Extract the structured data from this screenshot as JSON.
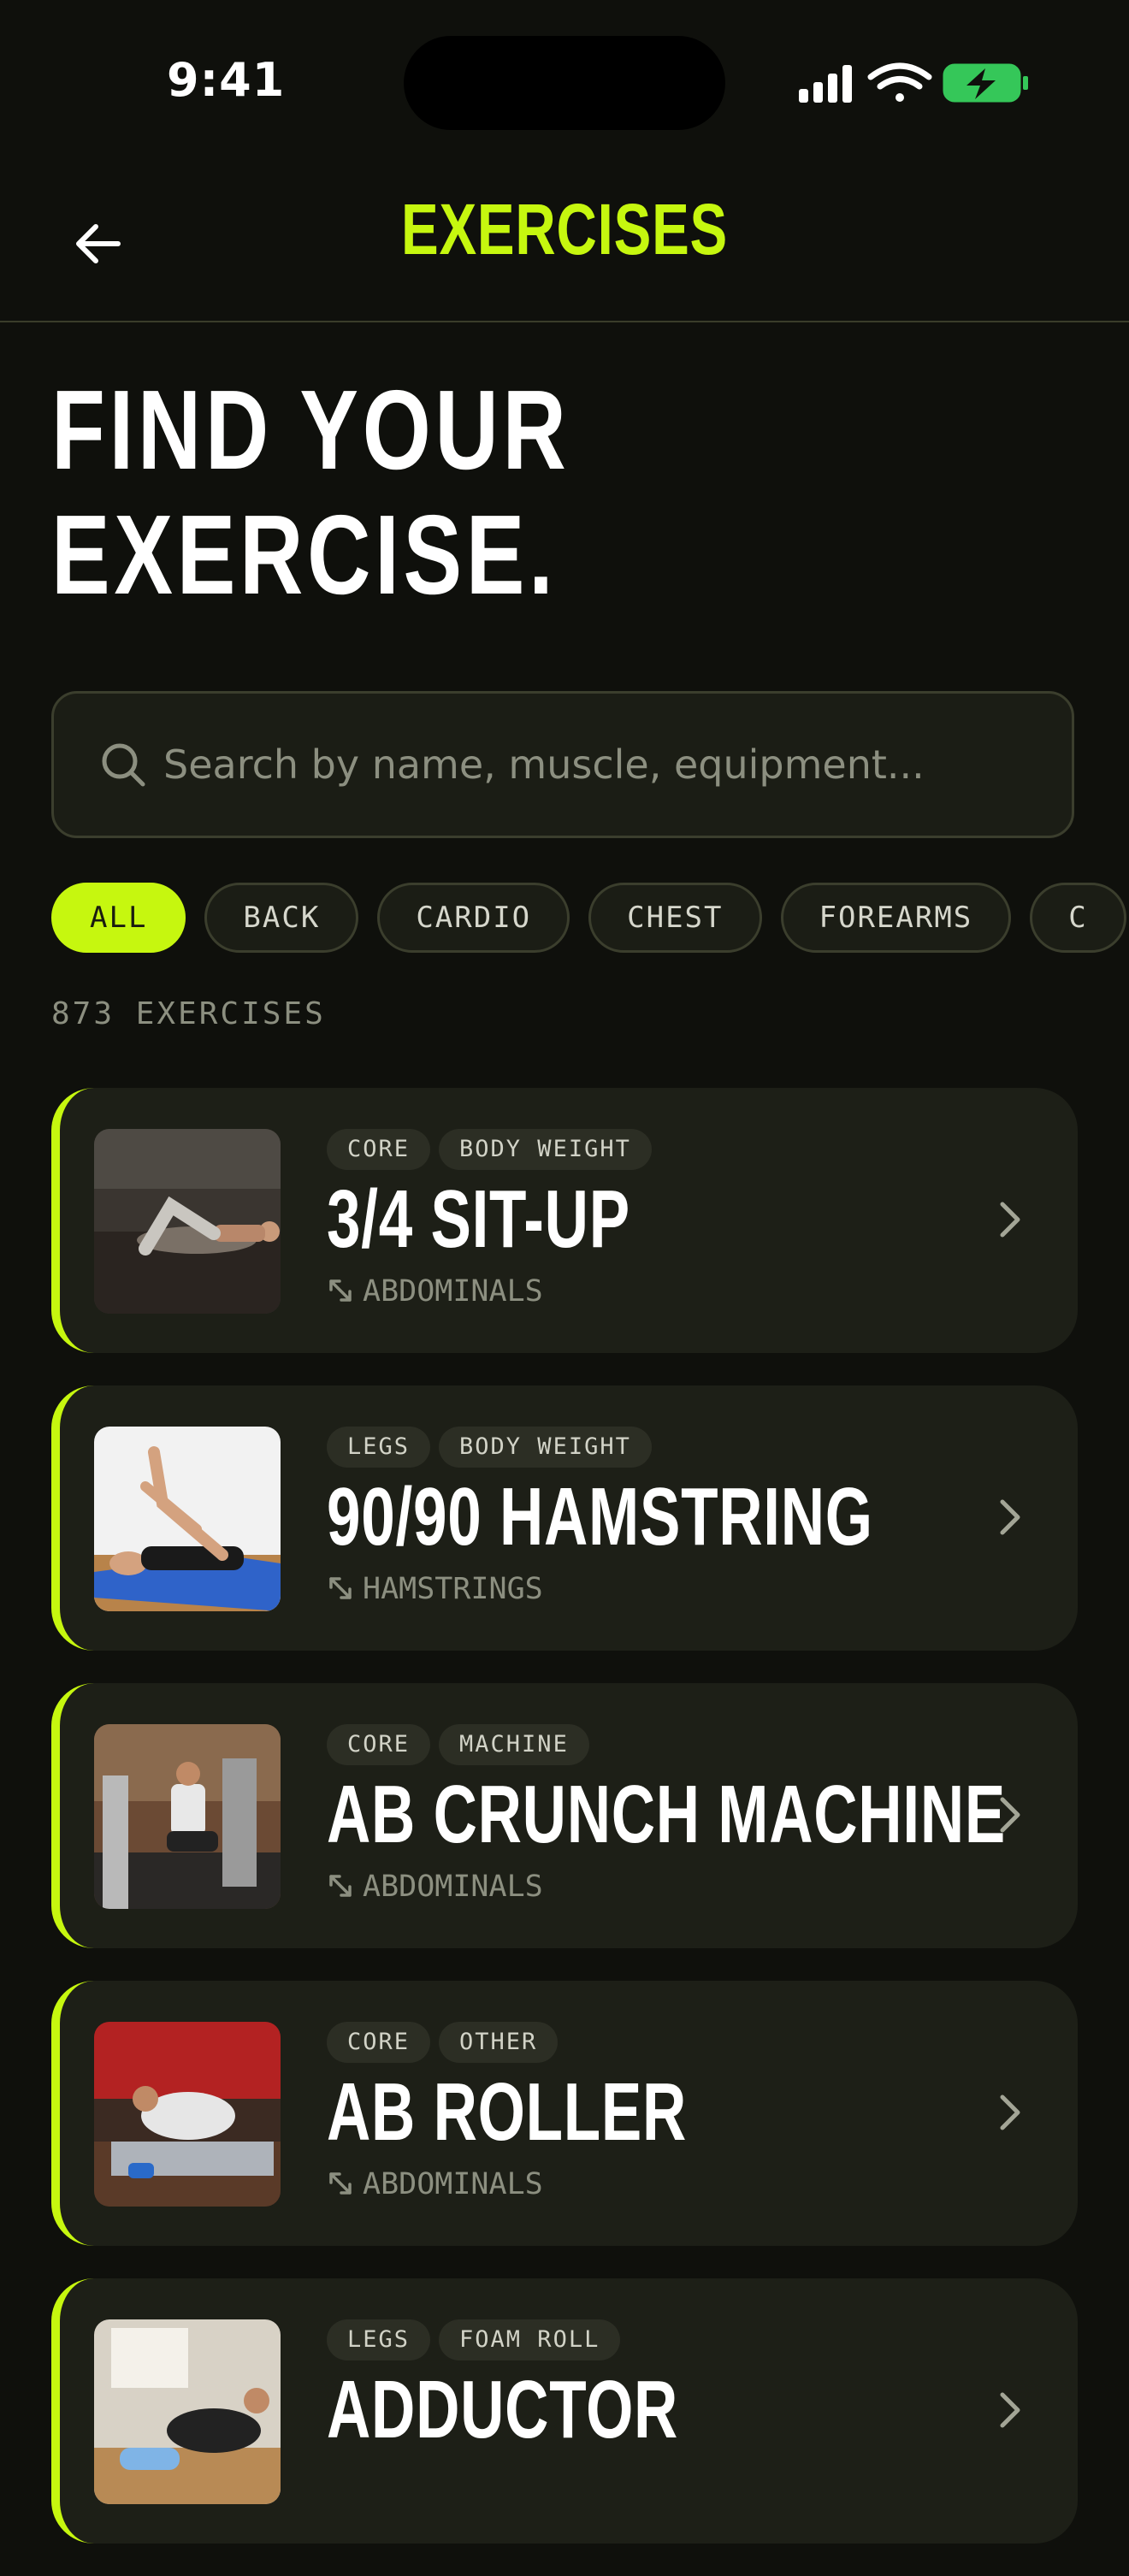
{
  "status": {
    "time": "9:41"
  },
  "nav": {
    "title": "EXERCISES"
  },
  "hero": {
    "line1": "FIND YOUR",
    "line2": "EXERCISE."
  },
  "search": {
    "placeholder": "Search by name, muscle, equipment..."
  },
  "filters": [
    "ALL",
    "BACK",
    "CARDIO",
    "CHEST",
    "FOREARMS",
    "C"
  ],
  "active_filter": "ALL",
  "count": "873 EXERCISES",
  "colors": {
    "accent": "#c6f70f",
    "background": "#0f100c",
    "card": "#1d1f17"
  },
  "exercises": [
    {
      "tags": [
        "CORE",
        "BODY WEIGHT"
      ],
      "name": "3/4 SIT-UP",
      "muscle": "ABDOMINALS"
    },
    {
      "tags": [
        "LEGS",
        "BODY WEIGHT"
      ],
      "name": "90/90 HAMSTRING",
      "muscle": "HAMSTRINGS"
    },
    {
      "tags": [
        "CORE",
        "MACHINE"
      ],
      "name": "AB CRUNCH MACHINE",
      "muscle": "ABDOMINALS"
    },
    {
      "tags": [
        "CORE",
        "OTHER"
      ],
      "name": "AB ROLLER",
      "muscle": "ABDOMINALS"
    },
    {
      "tags": [
        "LEGS",
        "FOAM ROLL"
      ],
      "name": "ADDUCTOR",
      "muscle": ""
    }
  ]
}
